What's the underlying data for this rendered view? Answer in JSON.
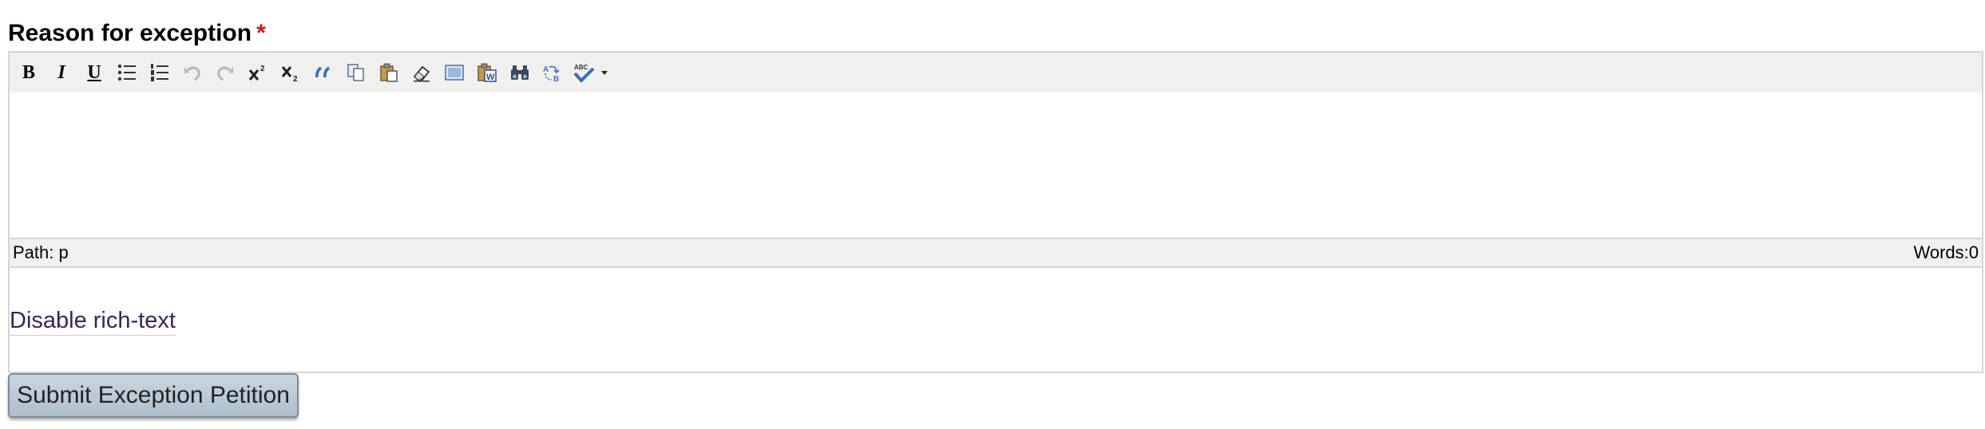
{
  "field": {
    "label": "Reason for exception",
    "required_mark": "*"
  },
  "toolbar": {
    "buttons": [
      {
        "name": "bold-icon",
        "glyph": "B",
        "title": "Bold"
      },
      {
        "name": "italic-icon",
        "glyph": "I",
        "title": "Italic"
      },
      {
        "name": "underline-icon",
        "glyph": "U",
        "title": "Underline"
      },
      {
        "name": "bullet-list-icon",
        "title": "Unordered list"
      },
      {
        "name": "numbered-list-icon",
        "title": "Ordered list"
      },
      {
        "name": "undo-icon",
        "title": "Undo"
      },
      {
        "name": "redo-icon",
        "title": "Redo"
      },
      {
        "name": "superscript-icon",
        "title": "Superscript"
      },
      {
        "name": "subscript-icon",
        "title": "Subscript"
      },
      {
        "name": "blockquote-icon",
        "title": "Blockquote"
      },
      {
        "name": "copy-icon",
        "title": "Copy"
      },
      {
        "name": "paste-icon",
        "title": "Paste"
      },
      {
        "name": "eraser-icon",
        "title": "Remove formatting"
      },
      {
        "name": "paste-text-icon",
        "title": "Paste as plain text"
      },
      {
        "name": "paste-word-icon",
        "title": "Paste from Word"
      },
      {
        "name": "find-icon",
        "title": "Find"
      },
      {
        "name": "replace-icon",
        "title": "Find/Replace"
      },
      {
        "name": "spellcheck-icon",
        "title": "Spellcheck"
      }
    ]
  },
  "editor": {
    "content": ""
  },
  "statusbar": {
    "path": "Path: p",
    "words": "Words:0"
  },
  "links": {
    "toggle_rich_text": "Disable rich-text"
  },
  "actions": {
    "submit_label": "Submit Exception Petition"
  },
  "colors": {
    "required": "#c41e1e",
    "toolbar_bg": "#f0f0ee",
    "link": "#3a2555",
    "button_bg": "#bccbd6"
  }
}
